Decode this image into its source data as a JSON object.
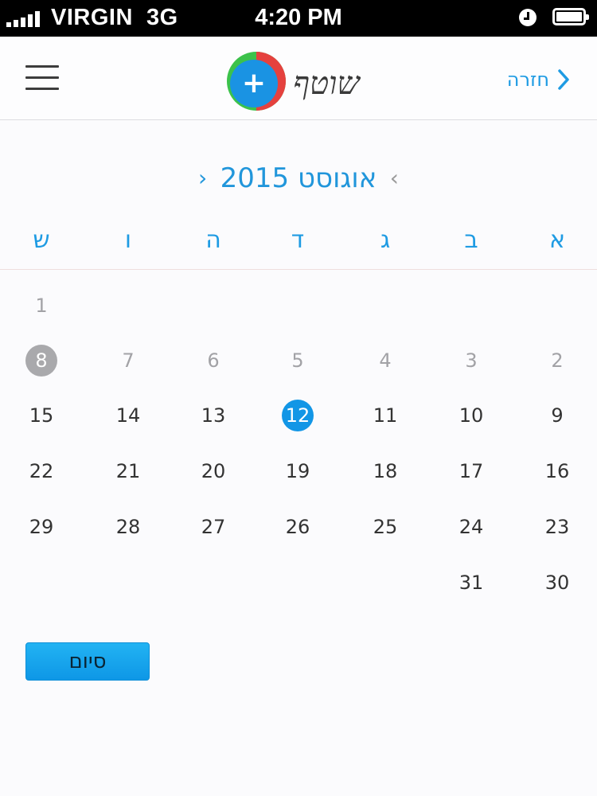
{
  "status_bar": {
    "carrier": "VIRGIN",
    "network": "3G",
    "time": "4:20 PM",
    "icons": [
      "signal-icon",
      "alarm-icon",
      "battery-icon"
    ]
  },
  "header": {
    "logo_text": "שוטף",
    "logo_plus": "+",
    "back_label": "חזרה",
    "menu_icon": "hamburger-menu-icon"
  },
  "calendar": {
    "month_title": "אוגוסט 2015",
    "weekdays": [
      "א",
      "ב",
      "ג",
      "ד",
      "ה",
      "ו",
      "ש"
    ],
    "rows": [
      [
        "",
        "",
        "",
        "",
        "",
        "",
        "1"
      ],
      [
        "2",
        "3",
        "4",
        "5",
        "6",
        "7",
        "8"
      ],
      [
        "9",
        "10",
        "11",
        "12",
        "13",
        "14",
        "15"
      ],
      [
        "16",
        "17",
        "18",
        "19",
        "20",
        "21",
        "22"
      ],
      [
        "23",
        "24",
        "25",
        "26",
        "27",
        "28",
        "29"
      ],
      [
        "30",
        "31",
        "",
        "",
        "",
        "",
        ""
      ]
    ],
    "today": "8",
    "selected": "12",
    "past_days_before": 9
  },
  "footer": {
    "done_label": "סיום"
  },
  "colors": {
    "accent": "#1e9be3",
    "selected_day": "#1296e6",
    "today_day": "#a9a9ac",
    "past_day": "#a2a2a6",
    "day_text": "#333333"
  }
}
